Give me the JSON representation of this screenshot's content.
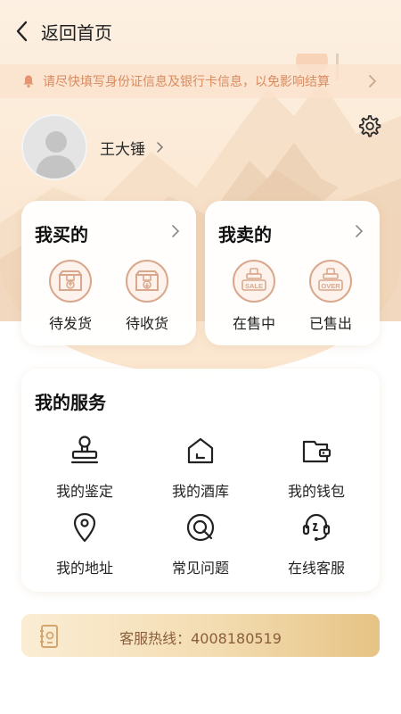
{
  "header": {
    "back_label": "返回首页"
  },
  "notice": {
    "text": "请尽快填写身份证信息及银行卡信息，以免影响结算"
  },
  "profile": {
    "name": "王大锤"
  },
  "buy_card": {
    "title": "我买的",
    "items": [
      {
        "label": "待发货",
        "icon": "box-upload-icon"
      },
      {
        "label": "待收货",
        "icon": "box-download-icon"
      }
    ]
  },
  "sell_card": {
    "title": "我卖的",
    "items": [
      {
        "label": "在售中",
        "icon": "sale-stamp-icon",
        "badge": "SALE"
      },
      {
        "label": "已售出",
        "icon": "over-stamp-icon",
        "badge": "OVER"
      }
    ]
  },
  "services": {
    "title": "我的服务",
    "items": [
      {
        "label": "我的鉴定",
        "icon": "stamp-icon"
      },
      {
        "label": "我的酒库",
        "icon": "house-icon"
      },
      {
        "label": "我的钱包",
        "icon": "wallet-icon"
      },
      {
        "label": "我的地址",
        "icon": "location-pin-icon"
      },
      {
        "label": "常见问题",
        "icon": "question-icon"
      },
      {
        "label": "在线客服",
        "icon": "headset-icon"
      }
    ]
  },
  "hotline": {
    "label": "客服热线：",
    "number": "4008180519"
  },
  "colors": {
    "accent": "#d9a88c",
    "notice_text": "#d98b5f",
    "hotline_text": "#8a5e3c",
    "background": "#fdf0e2"
  }
}
